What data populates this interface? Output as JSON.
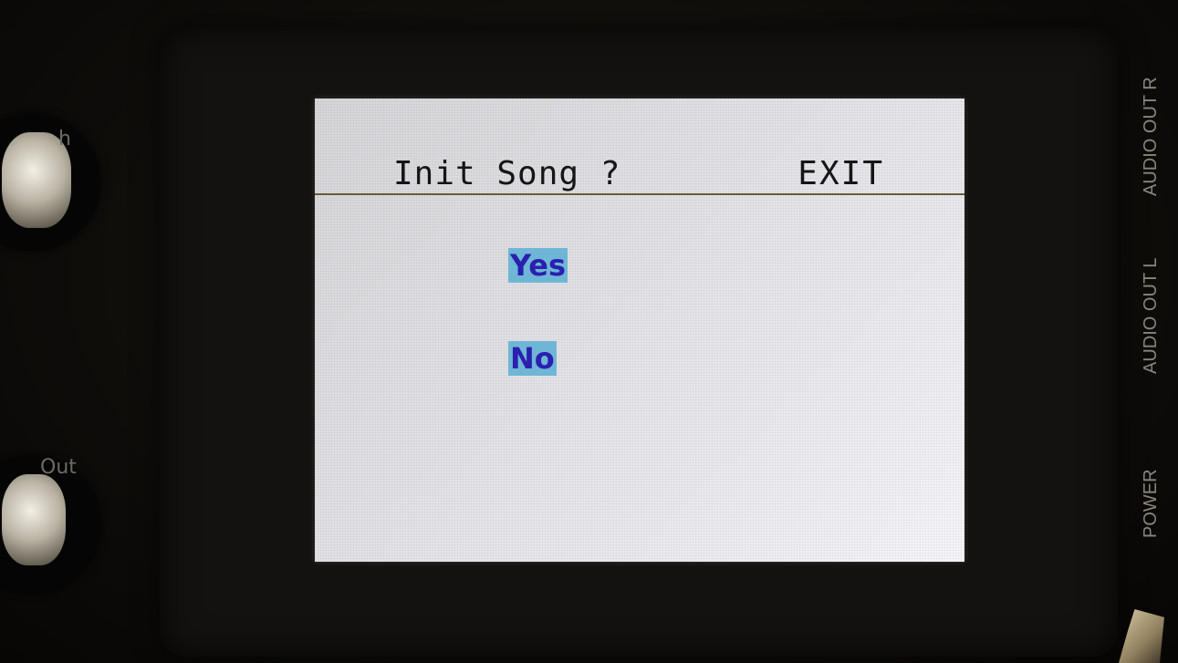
{
  "screen": {
    "title": "Init Song ?",
    "exit_label": "EXIT",
    "options": [
      {
        "label": "Yes",
        "selected": true
      },
      {
        "label": "No",
        "selected": false
      }
    ]
  },
  "panel": {
    "knob_labels": [
      "h",
      "Out"
    ],
    "jack_labels": [
      "AUDIO OUT R",
      "AUDIO OUT L",
      "POWER"
    ]
  },
  "colors": {
    "screen_bg": "#e3e2e6",
    "option_text": "#2a1fb0",
    "option_highlight": "#6fb6d6",
    "header_rule": "#6b5a3a"
  }
}
